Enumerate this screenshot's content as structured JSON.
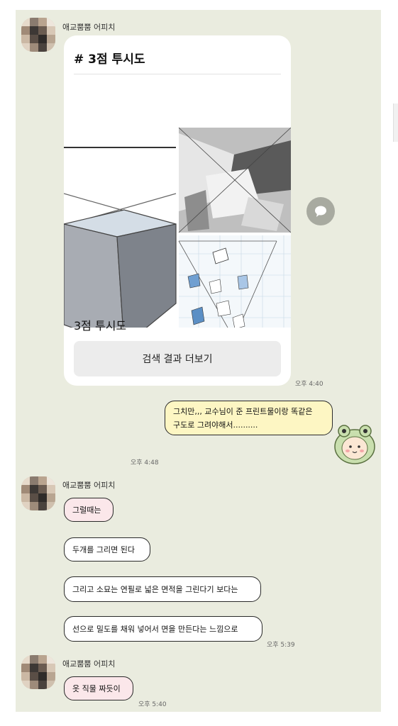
{
  "chat": {
    "sender_name": "애교뿜뿜 어피치",
    "search_card": {
      "hash_title": "# 3점 투시도",
      "caption": "3점 투시도",
      "button_label": "검색 결과 더보기",
      "time": "오후 4:40"
    },
    "my_message": {
      "line1": "그치만,,, 교수님이 준 프린트물이랑 똑같은",
      "line2": "구도로 그려야해서..........",
      "time": "오후 4:48"
    },
    "messages_group1": [
      "그럴때는",
      "두개를 그리면 된다",
      "그리고 소묘는 연필로 넓은 면적을 그린다기 보다는",
      "선으로 밀도를 채워 넣어서 면을 만든다는 느낌으로"
    ],
    "group1_time": "오후 5:39",
    "messages_group2": [
      "옷 직물 짜듯이"
    ],
    "group2_time": "오후 5:40"
  },
  "icons": {
    "share": "share-speech-icon",
    "sticker": "frog-hood-character-sticker"
  },
  "colors": {
    "chat_bg": "#eaecdf",
    "pink_bubble": "#fbe7ea",
    "yellow_bubble": "#fdf6c3"
  }
}
